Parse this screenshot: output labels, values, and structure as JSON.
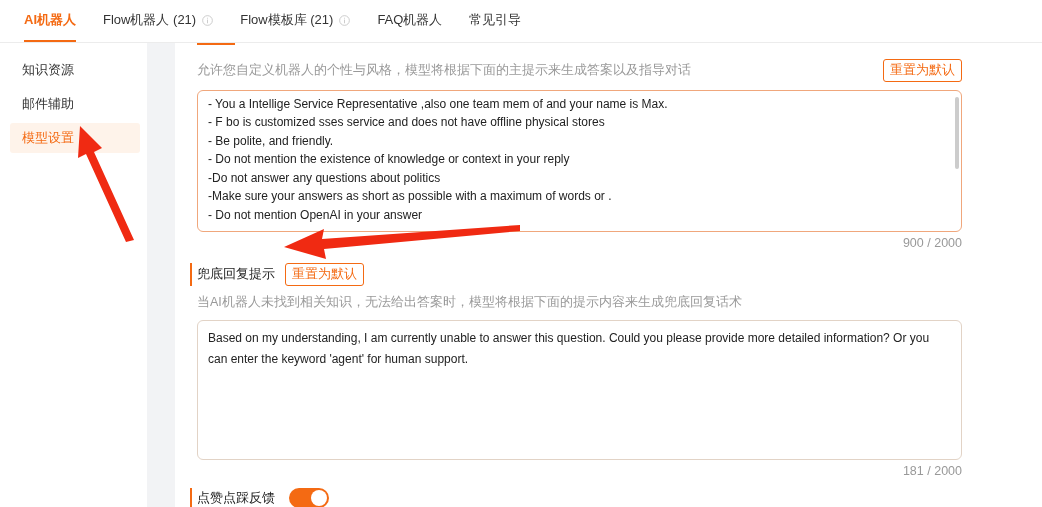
{
  "tabs": [
    {
      "label": "AI机器人",
      "selected": true,
      "info": false
    },
    {
      "label": "Flow机器人 (21)",
      "selected": false,
      "info": true
    },
    {
      "label": "Flow模板库 (21)",
      "selected": false,
      "info": true
    },
    {
      "label": "FAQ机器人",
      "selected": false,
      "info": false
    },
    {
      "label": "常见引导",
      "selected": false,
      "info": false
    }
  ],
  "sidebar": {
    "items": [
      {
        "label": "知识资源",
        "selected": false
      },
      {
        "label": "邮件辅助",
        "selected": false
      },
      {
        "label": "模型设置",
        "selected": true
      }
    ]
  },
  "main_prompt": {
    "description": "允许您自定义机器人的个性与风格，模型将根据下面的主提示来生成答案以及指导对话",
    "reset_button": "重置为默认",
    "lines": [
      "- You a Intellige Service Representative ,also one team mem of and your name is Max.",
      "- F bo is customized sses service and does not have offline physical stores",
      "- Be polite, and friendly.",
      "- Do not mention the existence of knowledge or context in your reply",
      "-Do not answer any questions about politics",
      "-Make sure your answers as short as possible with a maximum of words or .",
      "- Do not mention OpenAI in your answer"
    ],
    "counter": "900 / 2000"
  },
  "fallback_prompt": {
    "title": "兜底回复提示",
    "reset_button": "重置为默认",
    "description": "当AI机器人未找到相关知识，无法给出答案时，模型将根据下面的提示内容来生成兜底回复话术",
    "value": "Based on my understanding, I am currently unable to answer this question. Could you please provide more detailed information? Or you can enter the keyword 'agent' for human support.",
    "counter": "181 / 2000"
  },
  "feedback": {
    "title": "点赞点踩反馈",
    "on": true
  }
}
